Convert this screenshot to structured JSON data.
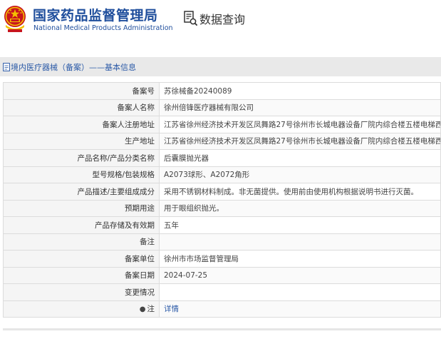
{
  "header": {
    "org_name_cn": "国家药品监督管理局",
    "org_name_en": "National Medical Products Administration",
    "query_label": "数据查询",
    "emblem_icon": "national-emblem-icon",
    "query_icon": "document-search-icon"
  },
  "section": {
    "icon": "document-icon",
    "title": "境内医疗器械（备案）——基本信息"
  },
  "record": {
    "rows": [
      {
        "label": "备案号",
        "value": "苏徐械备20240089"
      },
      {
        "label": "备案人名称",
        "value": "徐州倍锋医疗器械有限公司"
      },
      {
        "label": "备案人注册地址",
        "value": "江苏省徐州经济技术开发区凤舞路27号徐州市长城电器设备厂院内综合楼五楼电梯西"
      },
      {
        "label": "生产地址",
        "value": "江苏省徐州经济技术开发区凤舞路27号徐州市长城电器设备厂院内综合楼五楼电梯西"
      },
      {
        "label": "产品名称/产品分类名称",
        "value": "后囊膜抛光器"
      },
      {
        "label": "型号规格/包装规格",
        "value": "A2073球形、A2072角形"
      },
      {
        "label": "产品描述/主要组成成分",
        "value": "采用不锈钢材料制成。非无菌提供。使用前由使用机构根据说明书进行灭菌。"
      },
      {
        "label": "预期用途",
        "value": "用于眼组织抛光。"
      },
      {
        "label": "产品存储及有效期",
        "value": "五年"
      },
      {
        "label": "备注",
        "value": ""
      },
      {
        "label": "备案单位",
        "value": "徐州市市场监督管理局"
      },
      {
        "label": "备案日期",
        "value": "2024-07-25"
      },
      {
        "label": "变更情况",
        "value": ""
      }
    ],
    "note": {
      "label": "注",
      "link": "详情",
      "icon": "pin-icon"
    }
  }
}
